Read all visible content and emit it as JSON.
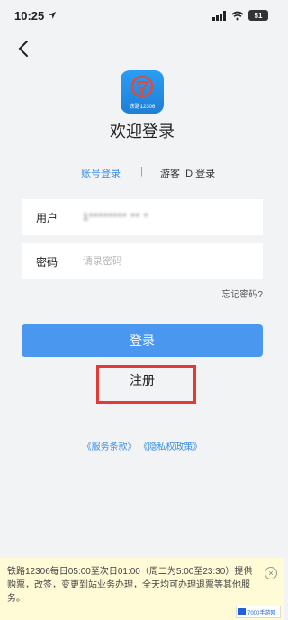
{
  "status_bar": {
    "time": "10:25",
    "battery": "51"
  },
  "app": {
    "logo_caption": "铁路12306",
    "welcome_title": "欢迎登录"
  },
  "tabs": {
    "account_login": "账号登录",
    "separator": "|",
    "guest_login": "游客 ID 登录"
  },
  "form": {
    "username_label": "用户",
    "username_value": "1******** ** *",
    "password_label": "密码",
    "password_placeholder": "请录密码",
    "forgot_password": "忘记密码?"
  },
  "buttons": {
    "login": "登录",
    "register": "注册"
  },
  "policy": {
    "text": "《服务条款》 《隐私权政策》"
  },
  "notice": {
    "text": "铁路12306每日05:00至次日01:00（周二为5:00至23:30）提供购票，改签，变更到站业务办理，全天均可办理退票等其他服务。",
    "close_symbol": "×"
  },
  "watermark": {
    "text": "7000手游网"
  },
  "colors": {
    "accent": "#4a97f0",
    "highlight": "#e53935",
    "notice_bg": "#fffbd6"
  }
}
